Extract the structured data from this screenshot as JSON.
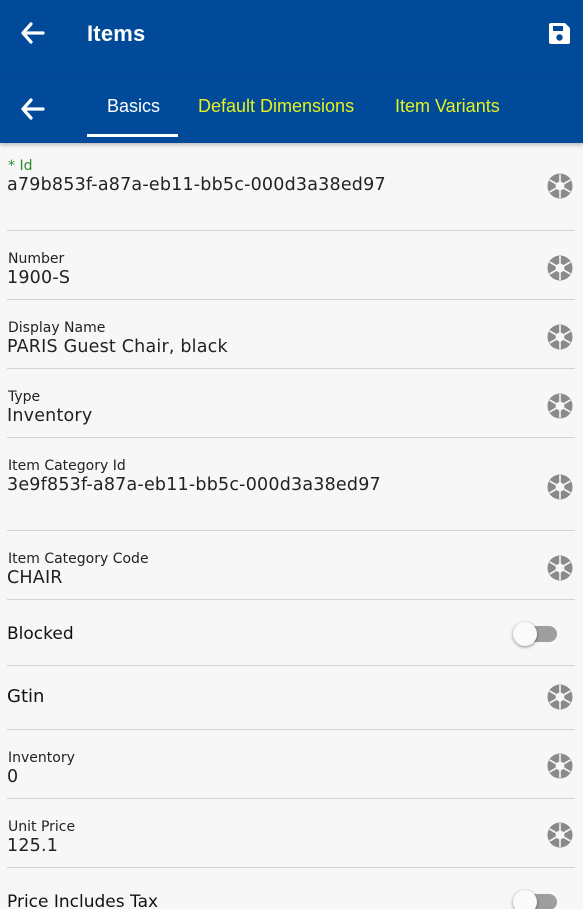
{
  "header": {
    "title": "Items"
  },
  "tabs": [
    {
      "label": "Basics"
    },
    {
      "label": "Default Dimensions"
    },
    {
      "label": "Item Variants"
    }
  ],
  "fields": {
    "id": {
      "label": "* Id",
      "value": "a79b853f-a87a-eb11-bb5c-000d3a38ed97"
    },
    "number": {
      "label": "Number",
      "value": "1900-S"
    },
    "display_name": {
      "label": "Display Name",
      "value": "PARIS Guest Chair, black"
    },
    "type": {
      "label": "Type",
      "value": "Inventory"
    },
    "item_category_id": {
      "label": "Item Category Id",
      "value": "3e9f853f-a87a-eb11-bb5c-000d3a38ed97"
    },
    "item_category_code": {
      "label": "Item Category Code",
      "value": "CHAIR"
    },
    "blocked": {
      "label": "Blocked",
      "checked": false
    },
    "gtin": {
      "label": "Gtin",
      "value": ""
    },
    "inventory": {
      "label": "Inventory",
      "value": "0"
    },
    "unit_price": {
      "label": "Unit Price",
      "value": "125.1"
    },
    "price_includes_tax": {
      "label": "Price Includes Tax",
      "checked": false
    }
  },
  "colors": {
    "primary": "#004a99",
    "tab_inactive": "#e5f21f",
    "required_label": "#2e8b2e",
    "icon_gray": "#8a8a8a"
  },
  "icons": {
    "back": "arrow-left-icon",
    "save": "floppy-disk-icon",
    "field_action": "camera-aperture-icon"
  }
}
